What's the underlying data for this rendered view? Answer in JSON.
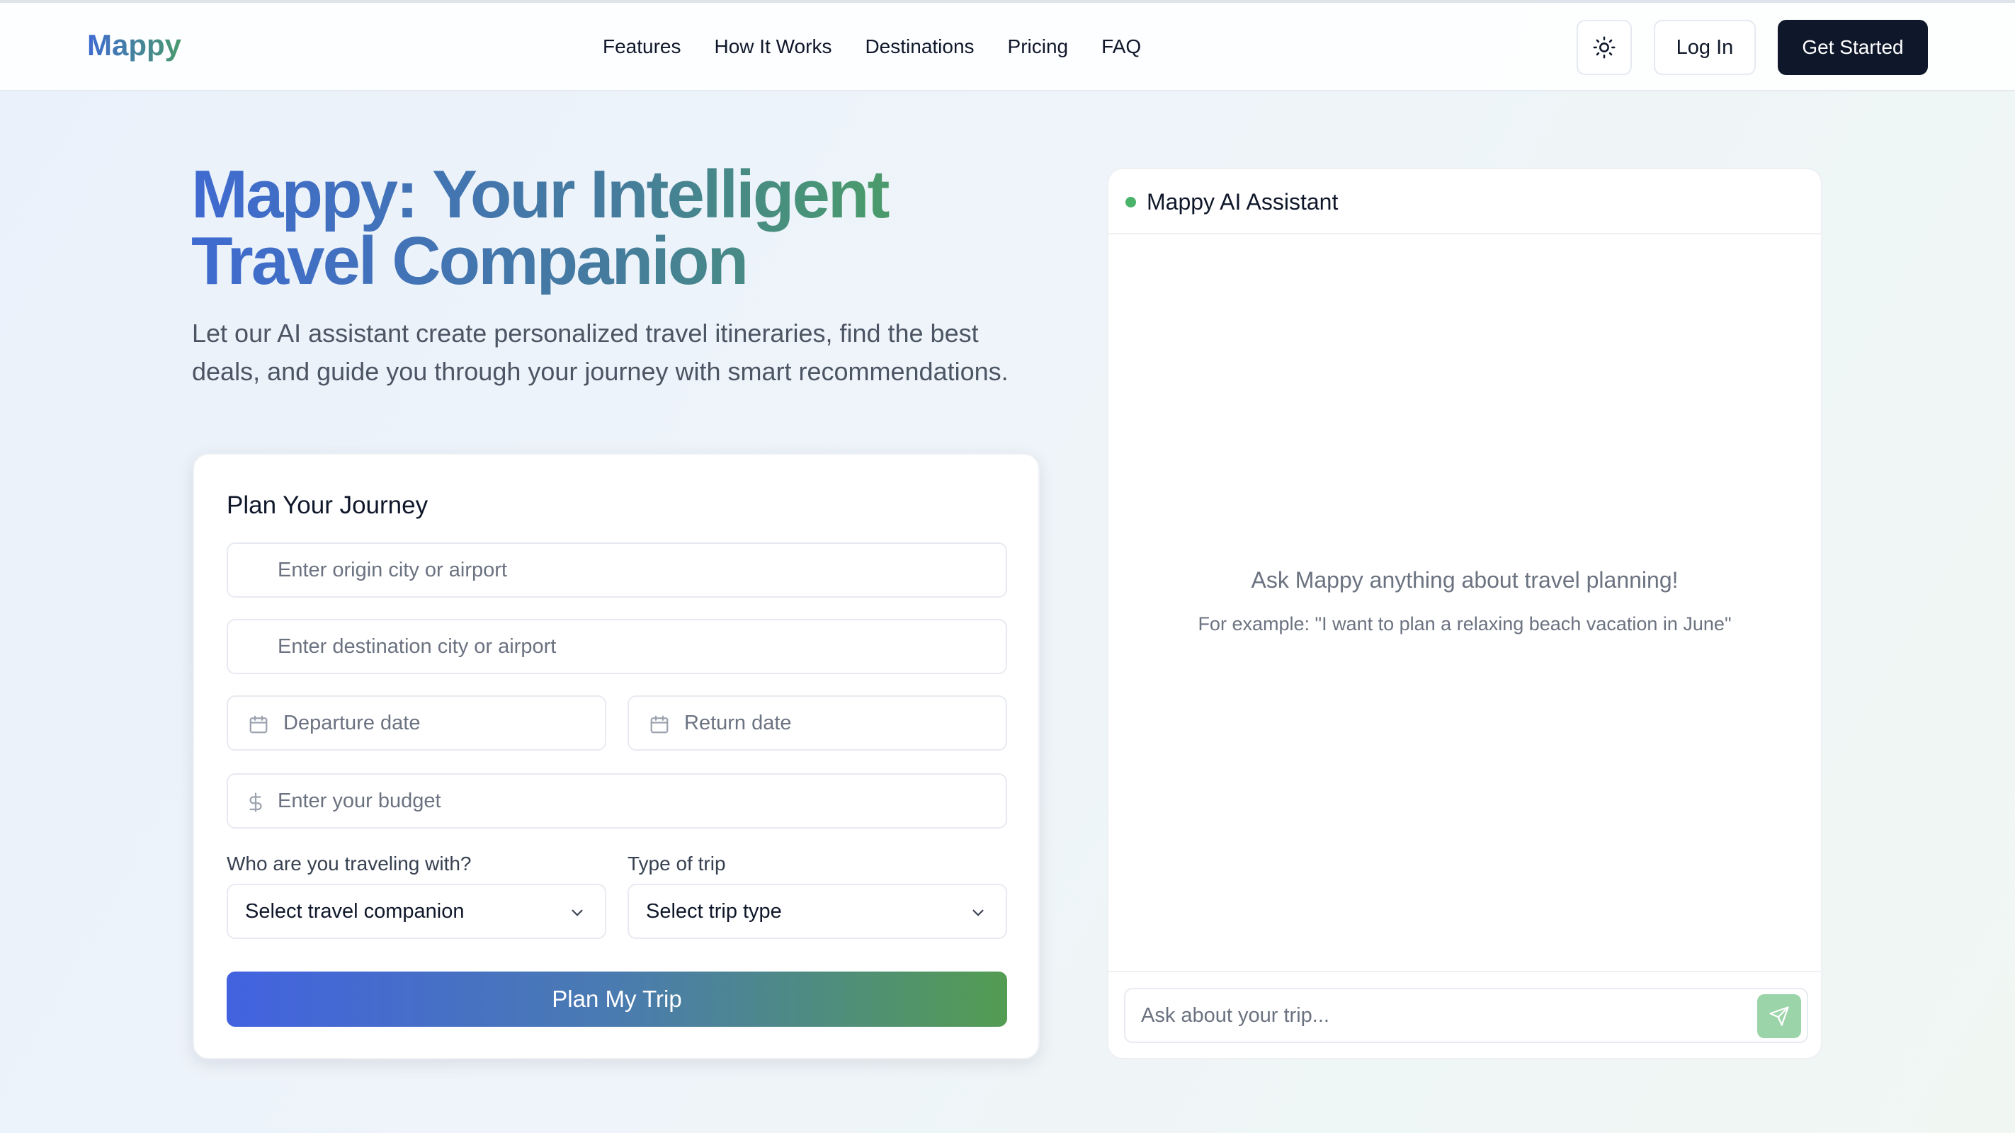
{
  "header": {
    "logo": "Mappy",
    "nav": [
      "Features",
      "How It Works",
      "Destinations",
      "Pricing",
      "FAQ"
    ],
    "theme_icon": "sun-icon",
    "login_label": "Log In",
    "get_started_label": "Get Started"
  },
  "hero": {
    "title_line1": "Mappy: Your Intelligent",
    "title_line2": "Travel Companion",
    "subtitle": "Let our AI assistant create personalized travel itineraries, find the best deals, and guide you through your journey with smart recommendations."
  },
  "planner": {
    "title": "Plan Your Journey",
    "origin_placeholder": "Enter origin city or airport",
    "destination_placeholder": "Enter destination city or airport",
    "departure_placeholder": "Departure date",
    "return_placeholder": "Return date",
    "budget_placeholder": "Enter your budget",
    "companion_label": "Who are you traveling with?",
    "companion_value": "Select travel companion",
    "trip_type_label": "Type of trip",
    "trip_type_value": "Select trip type",
    "submit_label": "Plan My Trip"
  },
  "assistant": {
    "title": "Mappy AI Assistant",
    "status_color": "#4ab36a",
    "empty_title": "Ask Mappy anything about travel planning!",
    "empty_example": "For example: \"I want to plan a relaxing beach vacation in June\"",
    "input_placeholder": "Ask about your trip...",
    "send_icon": "send-icon"
  },
  "colors": {
    "brand_blue": "#3f6ad1",
    "brand_green": "#4a9a6d",
    "dark_button": "#0f172a"
  }
}
